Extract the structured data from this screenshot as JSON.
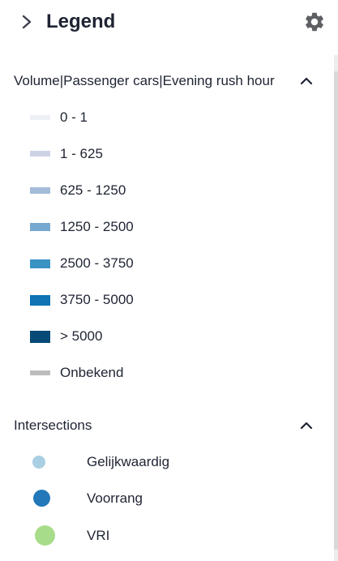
{
  "header": {
    "title": "Legend",
    "expand_icon": "chevron-right-icon",
    "settings_icon": "gear-icon"
  },
  "sections": [
    {
      "title": "Volume|Passenger cars|Evening rush hour",
      "toggle_icon": "chevron-up-icon",
      "items": [
        {
          "label": "0 - 1",
          "color": "#eef0f7"
        },
        {
          "label": "1 - 625",
          "color": "#cdd2e6"
        },
        {
          "label": "625 - 1250",
          "color": "#a4bcd9"
        },
        {
          "label": "1250 - 2500",
          "color": "#76a8d0"
        },
        {
          "label": "2500 - 3750",
          "color": "#3b93c4"
        },
        {
          "label": "3750 - 5000",
          "color": "#0f73b4"
        },
        {
          "label": "> 5000",
          "color": "#074a75"
        },
        {
          "label": "Onbekend",
          "color": "#bdbdbd"
        }
      ]
    },
    {
      "title": "Intersections",
      "toggle_icon": "chevron-up-icon",
      "items": [
        {
          "label": "Gelijkwaardig",
          "color": "#a9cfe3"
        },
        {
          "label": "Voorrang",
          "color": "#2278b8"
        },
        {
          "label": "VRI",
          "color": "#a7dc8b"
        }
      ]
    }
  ]
}
